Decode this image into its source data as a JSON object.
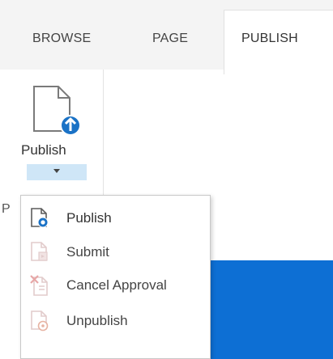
{
  "ribbon": {
    "tabs": [
      {
        "label": "BROWSE",
        "selected": false
      },
      {
        "label": "PAGE",
        "selected": false
      },
      {
        "label": "PUBLISH",
        "selected": true
      }
    ],
    "group_label_partial": "P"
  },
  "publish_button": {
    "label": "Publish",
    "icon": "document-upload-icon",
    "dropdown_icon": "chevron-down-icon"
  },
  "menu": {
    "items": [
      {
        "label": "Publish",
        "icon": "publish-document-icon",
        "enabled": true
      },
      {
        "label": "Submit",
        "icon": "submit-document-icon",
        "enabled": false
      },
      {
        "label": "Cancel Approval",
        "icon": "cancel-approval-icon",
        "enabled": false
      },
      {
        "label": "Unpublish",
        "icon": "unpublish-document-icon",
        "enabled": true
      }
    ]
  },
  "colors": {
    "accent_blue": "#0d6fd4",
    "dropdown_highlight": "#cfe6f7",
    "disabled_icon": "#d8b9b9"
  }
}
